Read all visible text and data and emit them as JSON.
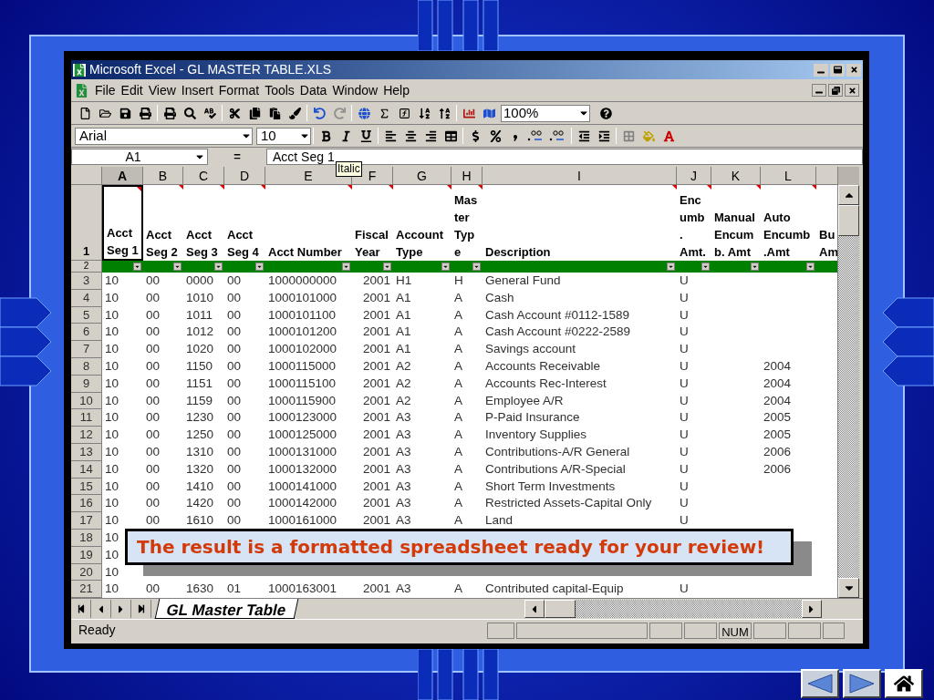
{
  "window": {
    "title": "Microsoft Excel - GL MASTER TABLE.XLS"
  },
  "menu_bar": [
    "File",
    "Edit",
    "View",
    "Insert",
    "Format",
    "Tools",
    "Data",
    "Window",
    "Help"
  ],
  "standard_toolbar": {
    "zoom": "100%"
  },
  "formatting_toolbar": {
    "font": "Arial",
    "size": "10"
  },
  "tooltip": "Italic",
  "formula_bar": {
    "name_box": "A1",
    "equals_sign": "=",
    "value": "Acct Seg 1"
  },
  "column_headers": [
    {
      "label": "A",
      "selected": true
    },
    {
      "label": "B",
      "selected": false
    },
    {
      "label": "C",
      "selected": false
    },
    {
      "label": "D",
      "selected": false
    },
    {
      "label": "E",
      "selected": false
    },
    {
      "label": "F",
      "selected": false
    },
    {
      "label": "G",
      "selected": false
    },
    {
      "label": "H",
      "selected": false
    },
    {
      "label": "I",
      "selected": false
    },
    {
      "label": "J",
      "selected": false
    },
    {
      "label": "K",
      "selected": false
    },
    {
      "label": "L",
      "selected": false
    }
  ],
  "header_row": {
    "number": "1",
    "cells": [
      {
        "lines": [
          "Acct",
          "Seg 1"
        ],
        "comment": true,
        "filter": true
      },
      {
        "lines": [
          "Acct",
          "Seg 2"
        ],
        "comment": true,
        "filter": true
      },
      {
        "lines": [
          "Acct",
          "Seg 3"
        ],
        "comment": true,
        "filter": true
      },
      {
        "lines": [
          "Acct",
          "Seg 4"
        ],
        "comment": true,
        "filter": true
      },
      {
        "lines": [
          "Acct Number"
        ],
        "comment": true,
        "filter": true
      },
      {
        "lines": [
          "Fiscal",
          "Year"
        ],
        "comment": true,
        "filter": true
      },
      {
        "lines": [
          "Account",
          "Type"
        ],
        "comment": true,
        "filter": true
      },
      {
        "lines": [
          "Mas",
          "ter",
          "Typ",
          "e"
        ],
        "comment": true,
        "filter": true
      },
      {
        "lines": [
          "Description"
        ],
        "comment": true,
        "filter": true
      },
      {
        "lines": [
          "Enc",
          "umb",
          ".",
          "Amt."
        ],
        "comment": true,
        "filter": true
      },
      {
        "lines": [
          "Manual",
          "Encum",
          "b. Amt"
        ],
        "comment": true,
        "filter": true
      },
      {
        "lines": [
          "Auto",
          "Encumb",
          ".Amt"
        ],
        "comment": true,
        "filter": true
      },
      {
        "lines": [
          "Bu",
          "Am"
        ]
      }
    ]
  },
  "filter_row_number": "2",
  "rows": [
    {
      "number": "3",
      "cells": [
        "10",
        "00",
        "0000",
        "00",
        "1000000000",
        "2001",
        "H1",
        "H",
        "General Fund",
        "U"
      ]
    },
    {
      "number": "4",
      "cells": [
        "10",
        "00",
        "1010",
        "00",
        "1000101000",
        "2001",
        "A1",
        "A",
        "Cash",
        "U"
      ]
    },
    {
      "number": "5",
      "cells": [
        "10",
        "00",
        "1011",
        "00",
        "1000101100",
        "2001",
        "A1",
        "A",
        "Cash Account #0112-1589",
        "U"
      ]
    },
    {
      "number": "6",
      "cells": [
        "10",
        "00",
        "1012",
        "00",
        "1000101200",
        "2001",
        "A1",
        "A",
        "Cash Account #0222-2589",
        "U"
      ]
    },
    {
      "number": "7",
      "cells": [
        "10",
        "00",
        "1020",
        "00",
        "1000102000",
        "2001",
        "A1",
        "A",
        "Savings account",
        "U"
      ]
    },
    {
      "number": "8",
      "cells": [
        "10",
        "00",
        "1150",
        "00",
        "1000115000",
        "2001",
        "A2",
        "A",
        "Accounts Receivable",
        "U",
        null,
        "2004"
      ]
    },
    {
      "number": "9",
      "cells": [
        "10",
        "00",
        "1151",
        "00",
        "1000115100",
        "2001",
        "A2",
        "A",
        "Accounts Rec-Interest",
        "U",
        null,
        "2004"
      ]
    },
    {
      "number": "10",
      "cells": [
        "10",
        "00",
        "1159",
        "00",
        "1000115900",
        "2001",
        "A2",
        "A",
        "Employee A/R",
        "U",
        null,
        "2004"
      ]
    },
    {
      "number": "11",
      "cells": [
        "10",
        "00",
        "1230",
        "00",
        "1000123000",
        "2001",
        "A3",
        "A",
        "P-Paid Insurance",
        "U",
        null,
        "2005"
      ]
    },
    {
      "number": "12",
      "cells": [
        "10",
        "00",
        "1250",
        "00",
        "1000125000",
        "2001",
        "A3",
        "A",
        "Inventory Supplies",
        "U",
        null,
        "2005"
      ]
    },
    {
      "number": "13",
      "cells": [
        "10",
        "00",
        "1310",
        "00",
        "1000131000",
        "2001",
        "A3",
        "A",
        "Contributions-A/R General",
        "U",
        null,
        "2006"
      ]
    },
    {
      "number": "14",
      "cells": [
        "10",
        "00",
        "1320",
        "00",
        "1000132000",
        "2001",
        "A3",
        "A",
        "Contributions A/R-Special",
        "U",
        null,
        "2006"
      ]
    },
    {
      "number": "15",
      "cells": [
        "10",
        "00",
        "1410",
        "00",
        "1000141000",
        "2001",
        "A3",
        "A",
        "Short Term Investments",
        "U"
      ]
    },
    {
      "number": "16",
      "cells": [
        "10",
        "00",
        "1420",
        "00",
        "1000142000",
        "2001",
        "A3",
        "A",
        "Restricted Assets-Capital Only",
        "U"
      ]
    },
    {
      "number": "17",
      "cells": [
        "10",
        "00",
        "1610",
        "00",
        "1000161000",
        "2001",
        "A3",
        "A",
        "Land",
        "U"
      ]
    },
    {
      "number": "18",
      "cells": [
        "10"
      ]
    },
    {
      "number": "19",
      "cells": [
        "10"
      ]
    },
    {
      "number": "20",
      "cells": [
        "10"
      ]
    },
    {
      "number": "21",
      "cells": [
        "10",
        "00",
        "1630",
        "01",
        "1000163001",
        "2001",
        "A3",
        "A",
        "Contributed capital-Equip",
        "U"
      ]
    }
  ],
  "sheet_tabs": [
    {
      "label": "GL Master Table",
      "selected": true
    }
  ],
  "status_bar": {
    "text": "Ready",
    "indicators": [
      "NUM"
    ]
  },
  "callout": "The result is a formatted spreadsheet ready for your review!"
}
